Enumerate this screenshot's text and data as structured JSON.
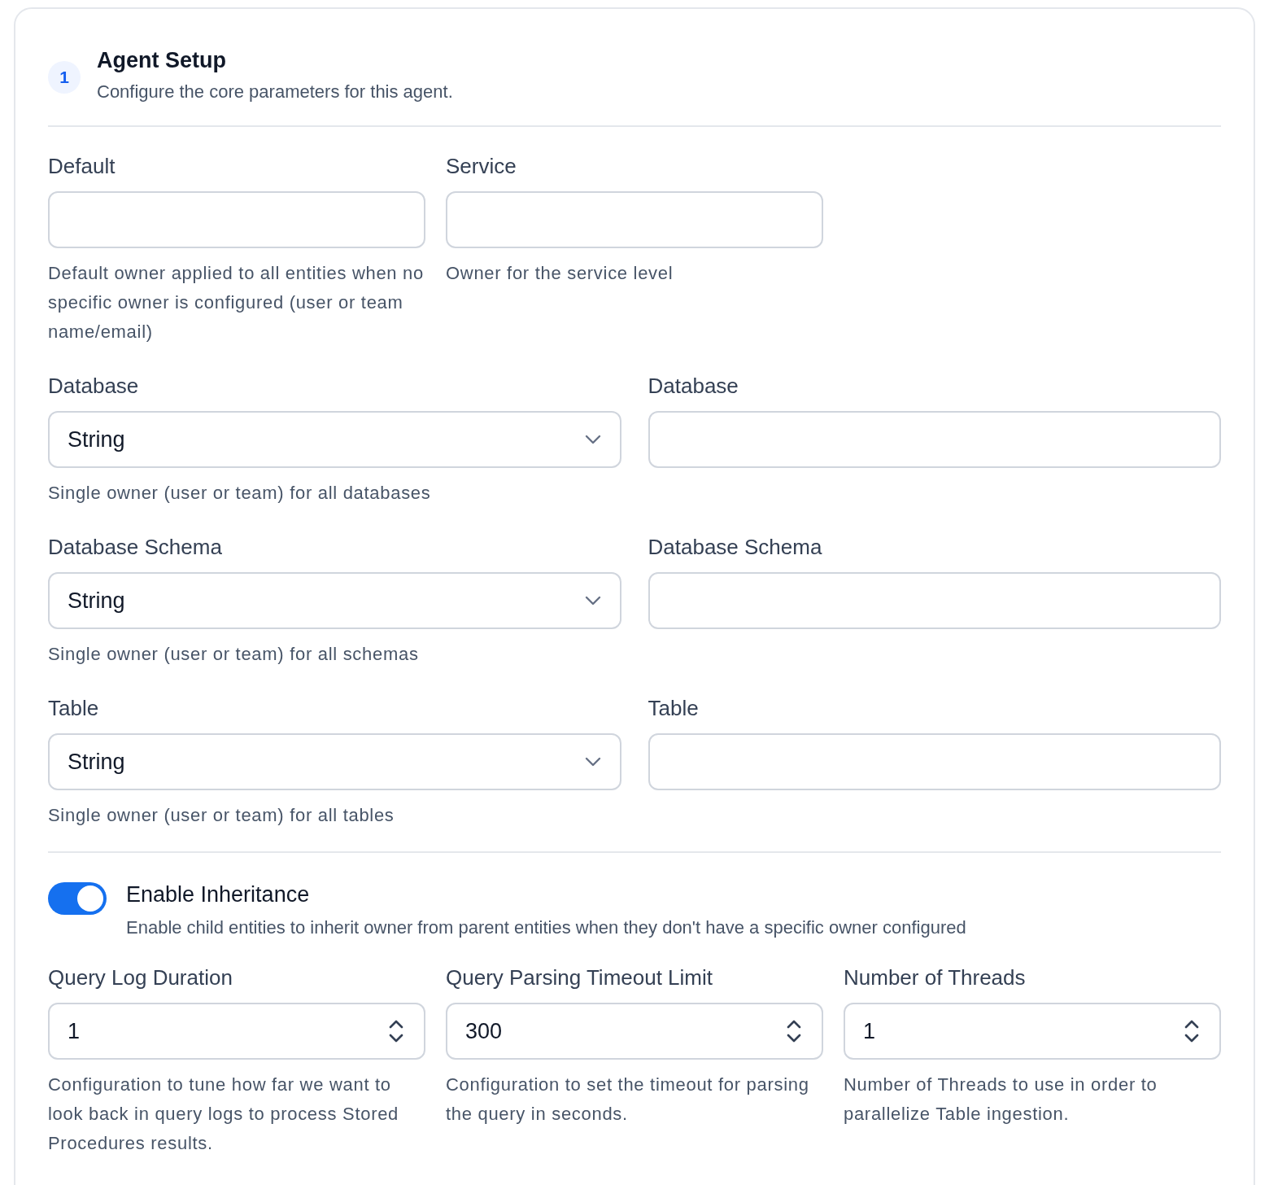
{
  "header": {
    "step": "1",
    "title": "Agent Setup",
    "subtitle": "Configure the core parameters for this agent."
  },
  "owner_fields": [
    {
      "label": "Default",
      "help": "Default owner applied to all entities when no specific owner is configured (user or team name/email)"
    },
    {
      "label": "Service",
      "help": "Owner for the service level"
    }
  ],
  "owner_pairs": [
    {
      "select": {
        "label": "Database",
        "value": "String",
        "help": "Single owner (user or team) for all databases"
      },
      "input": {
        "label": "Database"
      }
    },
    {
      "select": {
        "label": "Database Schema",
        "value": "String",
        "help": "Single owner (user or team) for all schemas"
      },
      "input": {
        "label": "Database Schema"
      }
    },
    {
      "select": {
        "label": "Table",
        "value": "String",
        "help": "Single owner (user or team) for all tables"
      },
      "input": {
        "label": "Table"
      }
    }
  ],
  "inheritance": {
    "label": "Enable Inheritance",
    "description": "Enable child entities to inherit owner from parent entities when they don't have a specific owner configured",
    "on": true
  },
  "numbers": [
    {
      "label": "Query Log Duration",
      "value": "1",
      "help": "Configuration to tune how far we want to look back in query logs to process Stored Procedures results."
    },
    {
      "label": "Query Parsing Timeout Limit",
      "value": "300",
      "help": "Configuration to set the timeout for parsing the query in seconds."
    },
    {
      "label": "Number of Threads",
      "value": "1",
      "help": "Number of Threads to use in order to parallelize Table ingestion."
    }
  ]
}
